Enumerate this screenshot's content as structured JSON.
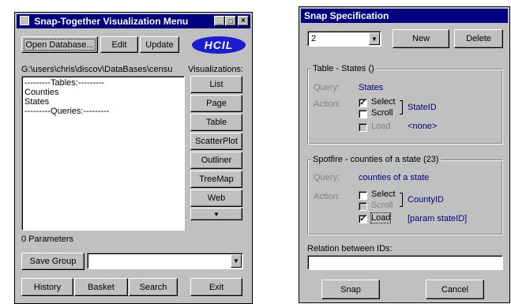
{
  "menu_window": {
    "title": "Snap-Together Visualization Menu",
    "title_buttons": [
      "_",
      "□",
      "×"
    ],
    "open_database": "Open Database...",
    "edit": "Edit",
    "update": "Update",
    "logo": "HCIL",
    "path": "G:\\users\\chris\\discov\\DataBases\\censu",
    "visualizations_label": "Visualizations:",
    "list_lines": [
      "---------Tables:---------",
      "Counties",
      "States",
      "---------Queries:---------"
    ],
    "viz_buttons": [
      "List",
      "Page",
      "Table",
      "ScatterPlot",
      "Outliner",
      "TreeMap",
      "Web"
    ],
    "viz_more": "▼",
    "parameters": "0 Parameters",
    "save_group": "Save Group",
    "save_group_value": "",
    "bottom_buttons": [
      "History",
      "Basket",
      "Search"
    ],
    "exit": "Exit"
  },
  "snap_window": {
    "title": "Snap Specification",
    "selector_value": "2",
    "new": "New",
    "delete": "Delete",
    "group1": {
      "title": "Table - States ()",
      "query_label": "Query:",
      "query_value": "States",
      "action_label": "Action:",
      "select": "Select",
      "scroll": "Scroll",
      "load": "Load",
      "select_checked": "✓",
      "load_checked": "",
      "id": "StateID",
      "load_param": "<none>"
    },
    "group2": {
      "title": "Spotfire - counties of a state (23)",
      "query_label": "Query:",
      "query_value": "counties of a state",
      "action_label": "Action:",
      "select": "Select",
      "scroll": "Scroll",
      "load": "Load",
      "select_checked": "",
      "load_checked": "✓",
      "id": "CountyID",
      "load_param": "[param stateID]"
    },
    "relation_label": "Relation between IDs:",
    "relation_value": "",
    "snap": "Snap",
    "cancel": "Cancel"
  }
}
